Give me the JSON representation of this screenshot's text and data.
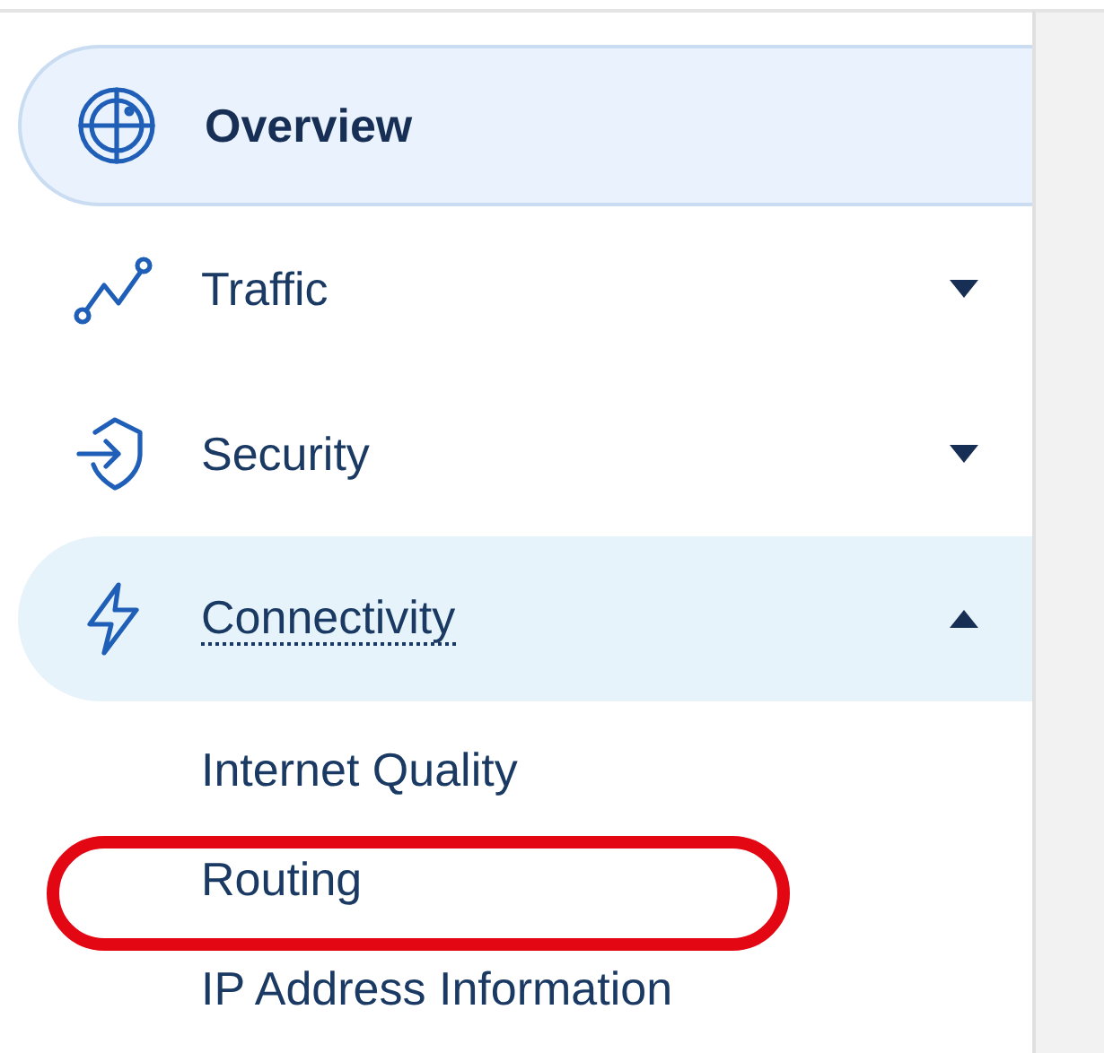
{
  "sidebar": {
    "items": [
      {
        "label": "Overview",
        "kind": "link",
        "selected": true
      },
      {
        "label": "Traffic",
        "kind": "group",
        "selected": false,
        "expanded": false
      },
      {
        "label": "Security",
        "kind": "group",
        "selected": false,
        "expanded": false
      },
      {
        "label": "Connectivity",
        "kind": "group",
        "selected": false,
        "expanded": true,
        "children": [
          {
            "label": "Internet Quality",
            "highlighted": false
          },
          {
            "label": "Routing",
            "highlighted": true
          },
          {
            "label": "IP Address Information",
            "highlighted": false
          }
        ]
      }
    ]
  }
}
